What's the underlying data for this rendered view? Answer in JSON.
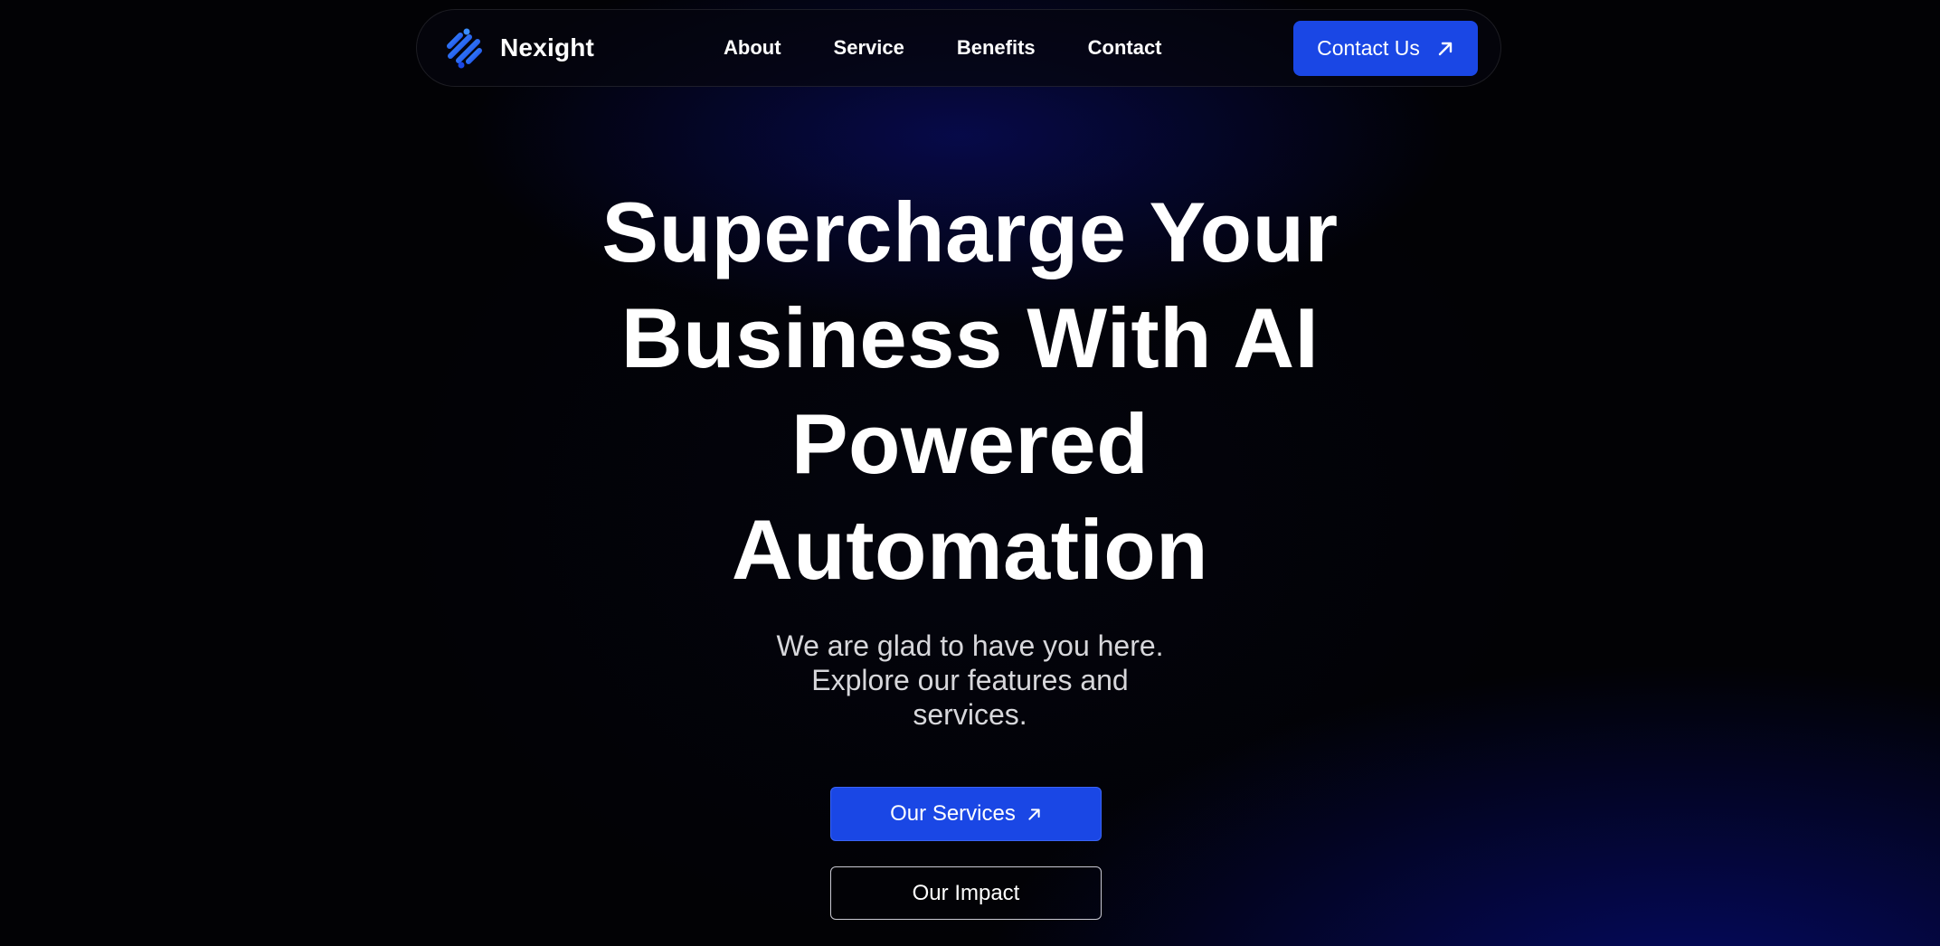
{
  "navbar": {
    "brand": {
      "name": "Nexight",
      "logo_icon": "nexight-logo-icon"
    },
    "links": [
      {
        "label": "About"
      },
      {
        "label": "Service"
      },
      {
        "label": "Benefits"
      },
      {
        "label": "Contact"
      }
    ],
    "cta": {
      "label": "Contact Us",
      "icon": "arrow-up-right-icon"
    }
  },
  "hero": {
    "title_lines": [
      "Supercharge Your",
      "Business With AI",
      "Powered",
      "Automation"
    ],
    "subtitle_lines": [
      "We are glad to have you here.",
      "Explore our features and",
      "services."
    ],
    "primary_button": {
      "label": "Our Services",
      "icon": "arrow-up-right-icon"
    },
    "secondary_button": {
      "label": "Our Impact"
    }
  },
  "colors": {
    "background": "#020205",
    "accent": "#1a47e5",
    "glow": "#050a69",
    "text": "#ffffff",
    "muted_text": "#d7d7db"
  }
}
